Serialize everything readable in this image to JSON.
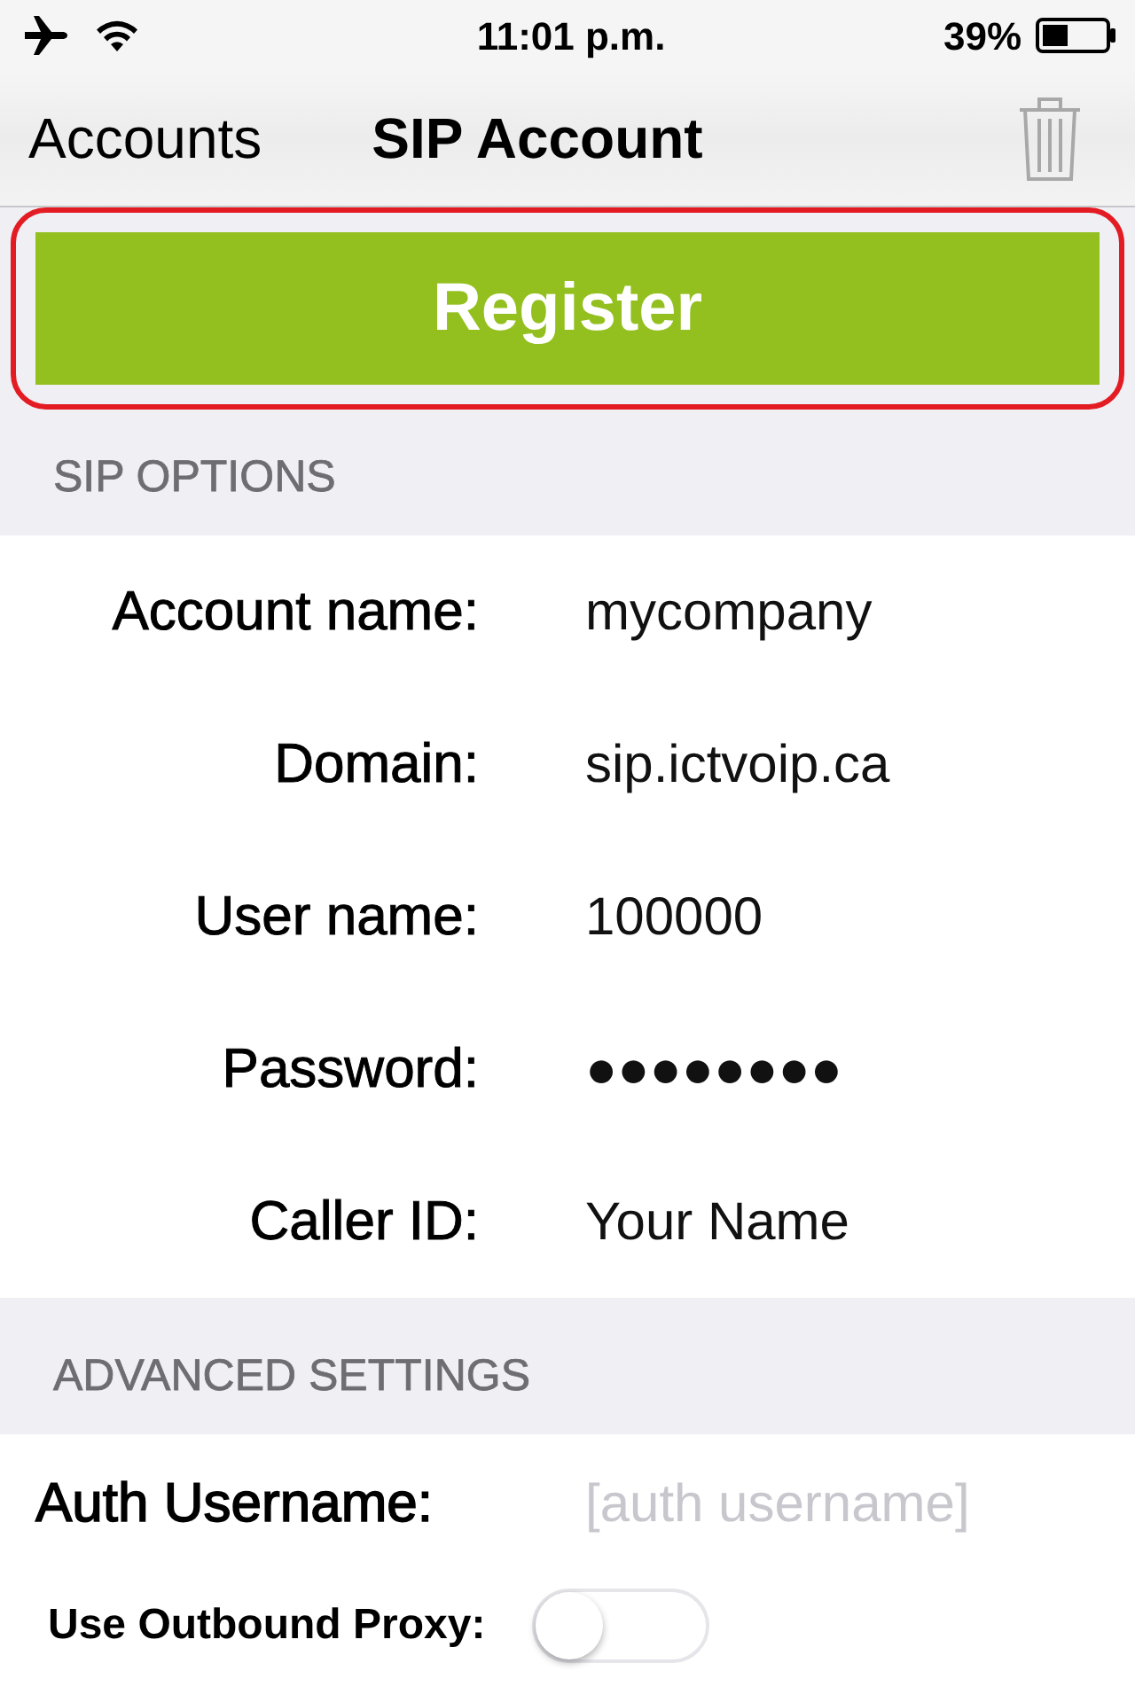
{
  "status_bar": {
    "time": "11:01 p.m.",
    "battery": "39%"
  },
  "nav_bar": {
    "back": "Accounts",
    "title": "SIP Account"
  },
  "register_button": {
    "label": "Register",
    "highlighted": true
  },
  "sections": [
    {
      "kind": "account",
      "header": "SIP OPTIONS",
      "rows": [
        {
          "kind": "field",
          "label": "Account name:",
          "value": "mycompany"
        },
        {
          "kind": "field",
          "label": "Domain:",
          "value": "sip.ictvoip.ca"
        },
        {
          "kind": "field",
          "label": "User name:",
          "value": "100000"
        },
        {
          "kind": "field",
          "label": "Password:",
          "value": "●●●●●●●●"
        },
        {
          "kind": "field",
          "label": "Caller ID:",
          "value": "Your Name"
        }
      ]
    },
    {
      "kind": "advanced",
      "header": "ADVANCED SETTINGS",
      "rows": [
        {
          "kind": "field",
          "label": "Auth Username:",
          "placeholder": "[auth username]"
        },
        {
          "kind": "toggle",
          "label": "Use Outbound Proxy:",
          "on": false
        }
      ]
    }
  ]
}
